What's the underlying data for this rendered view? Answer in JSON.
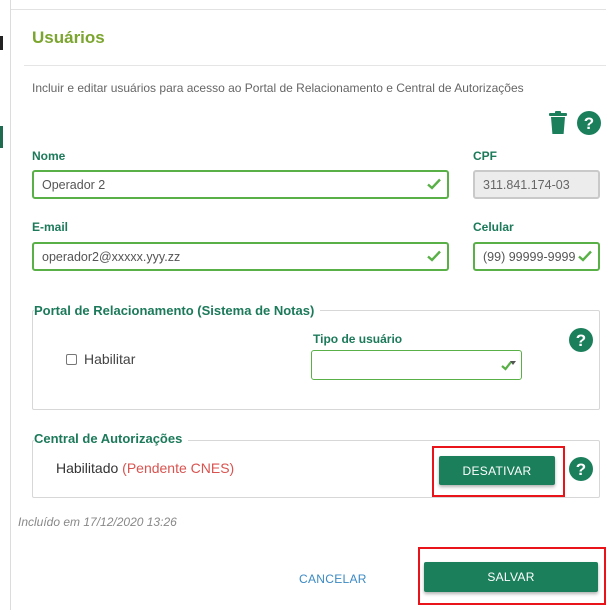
{
  "dialog": {
    "title": "Usuários",
    "subtitle": "Incluir e editar usuários para acesso ao Portal de Relacionamento e Central de Autorizações"
  },
  "toolbar": {
    "delete_icon": "trash-icon",
    "help_icon": "help-circle-icon"
  },
  "form": {
    "nome": {
      "label": "Nome",
      "value": "Operador 2"
    },
    "cpf": {
      "label": "CPF",
      "value": "311.841.174-03"
    },
    "email": {
      "label": "E-mail",
      "value": "operador2@xxxxx.yyy.zz"
    },
    "celular": {
      "label": "Celular",
      "value": "(99) 99999-9999"
    }
  },
  "portal_section": {
    "legend": "Portal de Relacionamento (Sistema de Notas)",
    "enable_label": "Habilitar",
    "enable_checked": false,
    "user_type_label": "Tipo de usuário",
    "user_type_value": ""
  },
  "central_section": {
    "legend": "Central de Autorizações",
    "status": "Habilitado",
    "status_note": "(Pendente CNES)",
    "deactivate_label": "DESATIVAR"
  },
  "footer": {
    "created_note": "Incluído em 17/12/2020 13:26",
    "cancel_label": "CANCELAR",
    "save_label": "SALVAR"
  },
  "colors": {
    "title": "#7ba52e",
    "label": "#1c7a5a",
    "field_border": "#58b046",
    "primary_button": "#1b7f5c",
    "link": "#3b8ac4",
    "pending": "#d9534f",
    "highlight": "#e8141a"
  }
}
